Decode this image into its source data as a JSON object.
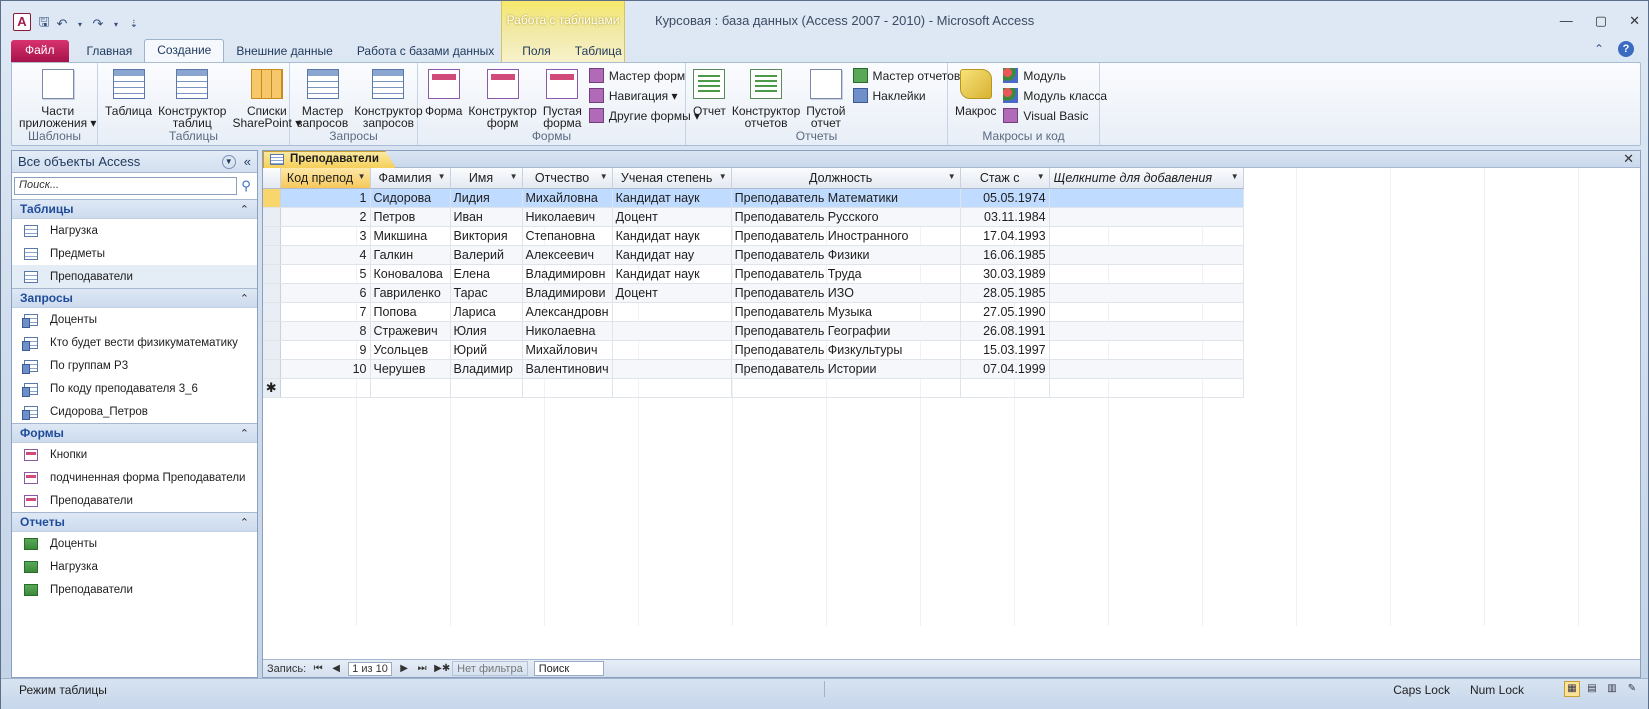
{
  "window": {
    "title": "Курсовая : база данных (Access 2007 - 2010)  -  Microsoft Access",
    "app_icon": "A",
    "qat": [
      "save-icon",
      "undo-icon",
      "redo-icon",
      "customize-icon"
    ],
    "controls": {
      "minimize": "—",
      "maximize": "▢",
      "close": "✕"
    }
  },
  "ribbon": {
    "context_group": "Работа с таблицами",
    "tabs": [
      {
        "label": "Файл",
        "kind": "file"
      },
      {
        "label": "Главная"
      },
      {
        "label": "Создание",
        "active": true
      },
      {
        "label": "Внешние данные"
      },
      {
        "label": "Работа с базами данных"
      },
      {
        "label": "Поля",
        "context": true
      },
      {
        "label": "Таблица",
        "context": true
      }
    ],
    "groups": {
      "templates": {
        "label": "Шаблоны",
        "app_parts": "Части\nприложения ▾"
      },
      "tables": {
        "label": "Таблицы",
        "table": "Таблица",
        "table_designer": "Конструктор\nтаблиц",
        "sharepoint": "Списки\nSharePoint ▾"
      },
      "queries": {
        "label": "Запросы",
        "wizard": "Мастер\nзапросов",
        "designer": "Конструктор\nзапросов"
      },
      "forms": {
        "label": "Формы",
        "form": "Форма",
        "designer": "Конструктор\nформ",
        "blank": "Пустая\nформа",
        "form_wizard": "Мастер форм",
        "navigation": "Навигация ▾",
        "more_forms": "Другие формы ▾"
      },
      "reports": {
        "label": "Отчеты",
        "report": "Отчет",
        "designer": "Конструктор\nотчетов",
        "blank": "Пустой\nотчет",
        "wizard": "Мастер отчетов",
        "labels": "Наклейки"
      },
      "macros": {
        "label": "Макросы и код",
        "macro": "Макрос",
        "module": "Модуль",
        "class_module": "Модуль класса",
        "vb": "Visual Basic"
      }
    },
    "help": "?"
  },
  "nav_pane": {
    "title": "Все объекты Access",
    "search_placeholder": "Поиск...",
    "sections": [
      {
        "name": "Таблицы",
        "items": [
          "Нагрузка",
          "Предметы",
          "Преподаватели"
        ],
        "kind": "table",
        "selected": 2
      },
      {
        "name": "Запросы",
        "items": [
          "Доценты",
          "Кто будет вести физикуматематику",
          "По группам Р3",
          "По коду преподавателя 3_6",
          "Сидорова_Петров"
        ],
        "kind": "query"
      },
      {
        "name": "Формы",
        "items": [
          "Кнопки",
          "подчиненная форма Преподаватели",
          "Преподаватели"
        ],
        "kind": "form"
      },
      {
        "name": "Отчеты",
        "items": [
          "Доценты",
          "Нагрузка",
          "Преподаватели"
        ],
        "kind": "report"
      }
    ]
  },
  "document": {
    "tab_title": "Преподаватели",
    "columns": [
      "Код препод",
      "Фамилия",
      "Имя",
      "Отчество",
      "Ученая степень",
      "Должность",
      "Стаж с",
      "Щелкните для добавления"
    ],
    "rows": [
      [
        "1",
        "Сидорова",
        "Лидия",
        "Михайловна",
        "Кандидат наук",
        "Преподаватель Математики",
        "05.05.1974"
      ],
      [
        "2",
        "Петров",
        "Иван",
        "Николаевич",
        "Доцент",
        "Преподаватель Русского",
        "03.11.1984"
      ],
      [
        "3",
        "Микшина",
        "Виктория",
        "Степановна",
        "Кандидат наук",
        "Преподаватель Иностранного",
        "17.04.1993"
      ],
      [
        "4",
        "Галкин",
        "Валерий",
        "Алексеевич",
        "Кандидат нау",
        "Преподаватель Физики",
        "16.06.1985"
      ],
      [
        "5",
        "Коновалова",
        "Елена",
        "Владимировн",
        "Кандидат наук",
        "Преподаватель Труда",
        "30.03.1989"
      ],
      [
        "6",
        "Гавриленко",
        "Тарас",
        "Владимирови",
        "Доцент",
        "Преподаватель ИЗО",
        "28.05.1985"
      ],
      [
        "7",
        "Попова",
        "Лариса",
        "Александровн",
        "",
        "Преподаватель Музыка",
        "27.05.1990"
      ],
      [
        "8",
        "Стражевич",
        "Юлия",
        "Николаевна",
        "",
        "Преподаватель Географии",
        "26.08.1991"
      ],
      [
        "9",
        "Усольцев",
        "Юрий",
        "Михайлович",
        "",
        "Преподаватель Физкультуры",
        "15.03.1997"
      ],
      [
        "10",
        "Черушев",
        "Владимир",
        "Валентинович",
        "",
        "Преподаватель Истории",
        "07.04.1999"
      ]
    ],
    "record_bar": {
      "label": "Запись:",
      "position": "1 из 10",
      "filter": "Нет фильтра",
      "search": "Поиск"
    }
  },
  "status_bar": {
    "mode": "Режим таблицы",
    "caps": "Caps Lock",
    "num": "Num Lock"
  }
}
